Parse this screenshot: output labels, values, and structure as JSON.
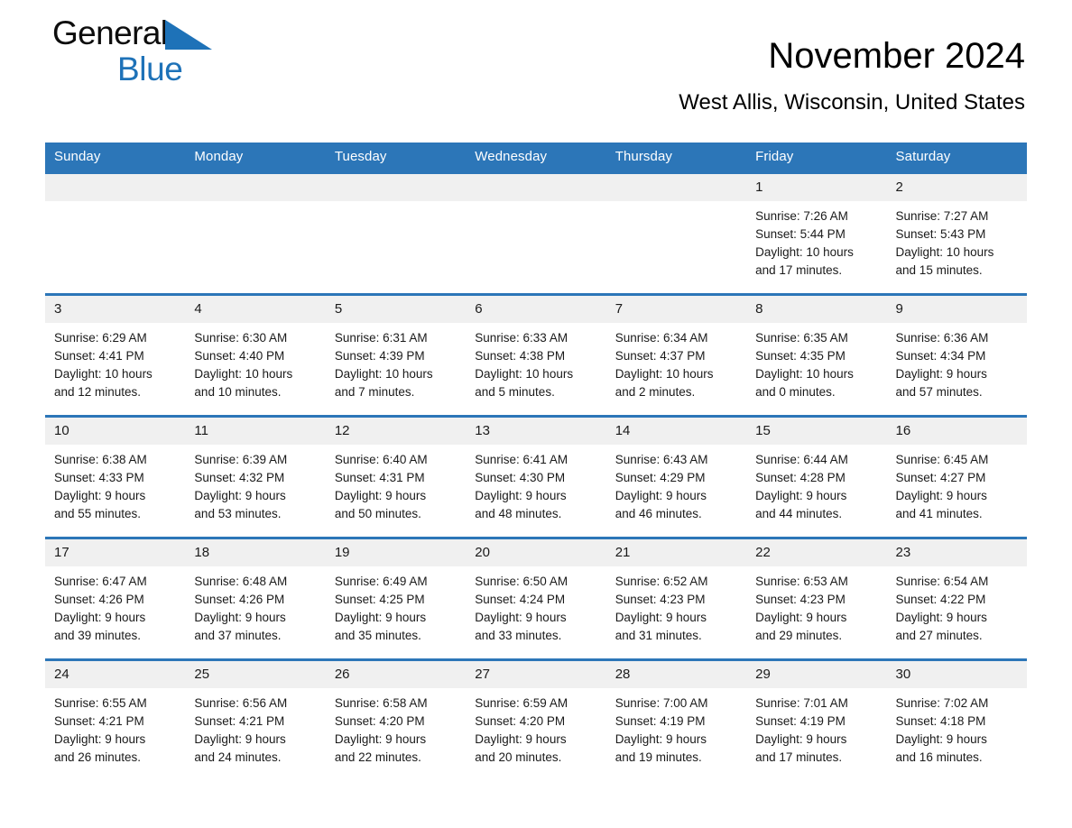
{
  "brand": {
    "name_part1": "General",
    "name_part2": "Blue",
    "triangle_color": "#1e72b8",
    "accent_color": "#2c76b8"
  },
  "header": {
    "title": "November 2024",
    "location": "West Allis, Wisconsin, United States"
  },
  "weekdays": [
    "Sunday",
    "Monday",
    "Tuesday",
    "Wednesday",
    "Thursday",
    "Friday",
    "Saturday"
  ],
  "labels": {
    "sunrise_prefix": "Sunrise: ",
    "sunset_prefix": "Sunset: ",
    "daylight_prefix": "Daylight: "
  },
  "weeks": [
    [
      {
        "day": "",
        "empty": true
      },
      {
        "day": "",
        "empty": true
      },
      {
        "day": "",
        "empty": true
      },
      {
        "day": "",
        "empty": true
      },
      {
        "day": "",
        "empty": true
      },
      {
        "day": "1",
        "sunrise": "Sunrise: 7:26 AM",
        "sunset": "Sunset: 5:44 PM",
        "daylight1": "Daylight: 10 hours",
        "daylight2": "and 17 minutes."
      },
      {
        "day": "2",
        "sunrise": "Sunrise: 7:27 AM",
        "sunset": "Sunset: 5:43 PM",
        "daylight1": "Daylight: 10 hours",
        "daylight2": "and 15 minutes."
      }
    ],
    [
      {
        "day": "3",
        "sunrise": "Sunrise: 6:29 AM",
        "sunset": "Sunset: 4:41 PM",
        "daylight1": "Daylight: 10 hours",
        "daylight2": "and 12 minutes."
      },
      {
        "day": "4",
        "sunrise": "Sunrise: 6:30 AM",
        "sunset": "Sunset: 4:40 PM",
        "daylight1": "Daylight: 10 hours",
        "daylight2": "and 10 minutes."
      },
      {
        "day": "5",
        "sunrise": "Sunrise: 6:31 AM",
        "sunset": "Sunset: 4:39 PM",
        "daylight1": "Daylight: 10 hours",
        "daylight2": "and 7 minutes."
      },
      {
        "day": "6",
        "sunrise": "Sunrise: 6:33 AM",
        "sunset": "Sunset: 4:38 PM",
        "daylight1": "Daylight: 10 hours",
        "daylight2": "and 5 minutes."
      },
      {
        "day": "7",
        "sunrise": "Sunrise: 6:34 AM",
        "sunset": "Sunset: 4:37 PM",
        "daylight1": "Daylight: 10 hours",
        "daylight2": "and 2 minutes."
      },
      {
        "day": "8",
        "sunrise": "Sunrise: 6:35 AM",
        "sunset": "Sunset: 4:35 PM",
        "daylight1": "Daylight: 10 hours",
        "daylight2": "and 0 minutes."
      },
      {
        "day": "9",
        "sunrise": "Sunrise: 6:36 AM",
        "sunset": "Sunset: 4:34 PM",
        "daylight1": "Daylight: 9 hours",
        "daylight2": "and 57 minutes."
      }
    ],
    [
      {
        "day": "10",
        "sunrise": "Sunrise: 6:38 AM",
        "sunset": "Sunset: 4:33 PM",
        "daylight1": "Daylight: 9 hours",
        "daylight2": "and 55 minutes."
      },
      {
        "day": "11",
        "sunrise": "Sunrise: 6:39 AM",
        "sunset": "Sunset: 4:32 PM",
        "daylight1": "Daylight: 9 hours",
        "daylight2": "and 53 minutes."
      },
      {
        "day": "12",
        "sunrise": "Sunrise: 6:40 AM",
        "sunset": "Sunset: 4:31 PM",
        "daylight1": "Daylight: 9 hours",
        "daylight2": "and 50 minutes."
      },
      {
        "day": "13",
        "sunrise": "Sunrise: 6:41 AM",
        "sunset": "Sunset: 4:30 PM",
        "daylight1": "Daylight: 9 hours",
        "daylight2": "and 48 minutes."
      },
      {
        "day": "14",
        "sunrise": "Sunrise: 6:43 AM",
        "sunset": "Sunset: 4:29 PM",
        "daylight1": "Daylight: 9 hours",
        "daylight2": "and 46 minutes."
      },
      {
        "day": "15",
        "sunrise": "Sunrise: 6:44 AM",
        "sunset": "Sunset: 4:28 PM",
        "daylight1": "Daylight: 9 hours",
        "daylight2": "and 44 minutes."
      },
      {
        "day": "16",
        "sunrise": "Sunrise: 6:45 AM",
        "sunset": "Sunset: 4:27 PM",
        "daylight1": "Daylight: 9 hours",
        "daylight2": "and 41 minutes."
      }
    ],
    [
      {
        "day": "17",
        "sunrise": "Sunrise: 6:47 AM",
        "sunset": "Sunset: 4:26 PM",
        "daylight1": "Daylight: 9 hours",
        "daylight2": "and 39 minutes."
      },
      {
        "day": "18",
        "sunrise": "Sunrise: 6:48 AM",
        "sunset": "Sunset: 4:26 PM",
        "daylight1": "Daylight: 9 hours",
        "daylight2": "and 37 minutes."
      },
      {
        "day": "19",
        "sunrise": "Sunrise: 6:49 AM",
        "sunset": "Sunset: 4:25 PM",
        "daylight1": "Daylight: 9 hours",
        "daylight2": "and 35 minutes."
      },
      {
        "day": "20",
        "sunrise": "Sunrise: 6:50 AM",
        "sunset": "Sunset: 4:24 PM",
        "daylight1": "Daylight: 9 hours",
        "daylight2": "and 33 minutes."
      },
      {
        "day": "21",
        "sunrise": "Sunrise: 6:52 AM",
        "sunset": "Sunset: 4:23 PM",
        "daylight1": "Daylight: 9 hours",
        "daylight2": "and 31 minutes."
      },
      {
        "day": "22",
        "sunrise": "Sunrise: 6:53 AM",
        "sunset": "Sunset: 4:23 PM",
        "daylight1": "Daylight: 9 hours",
        "daylight2": "and 29 minutes."
      },
      {
        "day": "23",
        "sunrise": "Sunrise: 6:54 AM",
        "sunset": "Sunset: 4:22 PM",
        "daylight1": "Daylight: 9 hours",
        "daylight2": "and 27 minutes."
      }
    ],
    [
      {
        "day": "24",
        "sunrise": "Sunrise: 6:55 AM",
        "sunset": "Sunset: 4:21 PM",
        "daylight1": "Daylight: 9 hours",
        "daylight2": "and 26 minutes."
      },
      {
        "day": "25",
        "sunrise": "Sunrise: 6:56 AM",
        "sunset": "Sunset: 4:21 PM",
        "daylight1": "Daylight: 9 hours",
        "daylight2": "and 24 minutes."
      },
      {
        "day": "26",
        "sunrise": "Sunrise: 6:58 AM",
        "sunset": "Sunset: 4:20 PM",
        "daylight1": "Daylight: 9 hours",
        "daylight2": "and 22 minutes."
      },
      {
        "day": "27",
        "sunrise": "Sunrise: 6:59 AM",
        "sunset": "Sunset: 4:20 PM",
        "daylight1": "Daylight: 9 hours",
        "daylight2": "and 20 minutes."
      },
      {
        "day": "28",
        "sunrise": "Sunrise: 7:00 AM",
        "sunset": "Sunset: 4:19 PM",
        "daylight1": "Daylight: 9 hours",
        "daylight2": "and 19 minutes."
      },
      {
        "day": "29",
        "sunrise": "Sunrise: 7:01 AM",
        "sunset": "Sunset: 4:19 PM",
        "daylight1": "Daylight: 9 hours",
        "daylight2": "and 17 minutes."
      },
      {
        "day": "30",
        "sunrise": "Sunrise: 7:02 AM",
        "sunset": "Sunset: 4:18 PM",
        "daylight1": "Daylight: 9 hours",
        "daylight2": "and 16 minutes."
      }
    ]
  ]
}
